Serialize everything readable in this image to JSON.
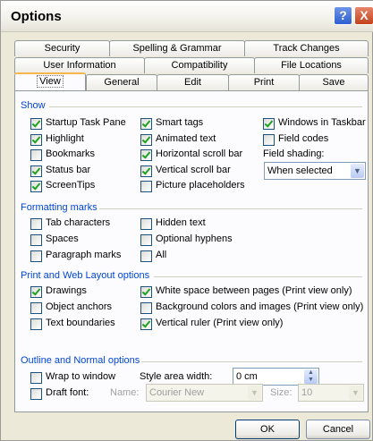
{
  "window": {
    "title": "Options",
    "help_glyph": "?",
    "close_glyph": "X"
  },
  "tabs": {
    "row1": [
      "Security",
      "Spelling & Grammar",
      "Track Changes"
    ],
    "row2": [
      "User Information",
      "Compatibility",
      "File Locations"
    ],
    "row3": [
      "View",
      "General",
      "Edit",
      "Print",
      "Save"
    ],
    "active": "View"
  },
  "show": {
    "title": "Show",
    "col1": [
      {
        "label": "Startup Task Pane",
        "checked": true
      },
      {
        "label": "Highlight",
        "checked": true
      },
      {
        "label": "Bookmarks",
        "checked": false
      },
      {
        "label": "Status bar",
        "checked": true
      },
      {
        "label": "ScreenTips",
        "checked": true
      }
    ],
    "col2": [
      {
        "label": "Smart tags",
        "checked": true
      },
      {
        "label": "Animated text",
        "checked": true
      },
      {
        "label": "Horizontal scroll bar",
        "checked": true
      },
      {
        "label": "Vertical scroll bar",
        "checked": true
      },
      {
        "label": "Picture placeholders",
        "checked": false
      }
    ],
    "col3": [
      {
        "label": "Windows in Taskbar",
        "checked": true
      },
      {
        "label": "Field codes",
        "checked": false
      }
    ],
    "field_shading_label": "Field shading:",
    "field_shading_value": "When selected"
  },
  "formatting": {
    "title": "Formatting marks",
    "col1": [
      {
        "label": "Tab characters",
        "checked": false
      },
      {
        "label": "Spaces",
        "checked": false
      },
      {
        "label": "Paragraph marks",
        "checked": false
      }
    ],
    "col2": [
      {
        "label": "Hidden text",
        "checked": false
      },
      {
        "label": "Optional hyphens",
        "checked": false
      },
      {
        "label": "All",
        "checked": false
      }
    ]
  },
  "print_web": {
    "title": "Print and Web Layout options",
    "col1": [
      {
        "label": "Drawings",
        "checked": true
      },
      {
        "label": "Object anchors",
        "checked": false
      },
      {
        "label": "Text boundaries",
        "checked": false
      }
    ],
    "col2": [
      {
        "label": "White space between pages (Print view only)",
        "checked": true
      },
      {
        "label": "Background colors and images (Print view only)",
        "checked": false
      },
      {
        "label": "Vertical ruler (Print view only)",
        "checked": true
      }
    ]
  },
  "outline": {
    "title": "Outline and Normal options",
    "wrap_to_window": {
      "label": "Wrap to window",
      "checked": false
    },
    "draft_font": {
      "label": "Draft font:",
      "checked": false
    },
    "style_area_label": "Style area width:",
    "style_area_value": "0 cm",
    "name_label": "Name:",
    "name_value": "Courier New",
    "size_label": "Size:",
    "size_value": "10"
  },
  "buttons": {
    "ok": "OK",
    "cancel": "Cancel"
  }
}
